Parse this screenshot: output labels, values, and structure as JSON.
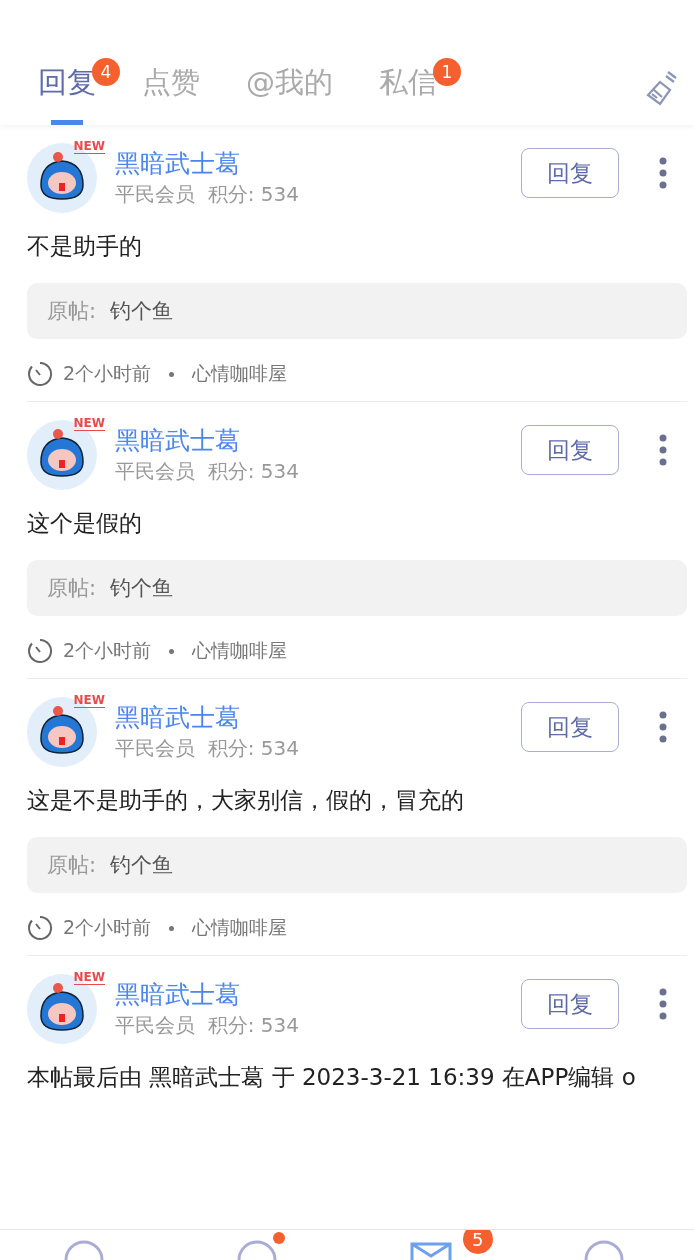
{
  "tabs": [
    {
      "label": "回复",
      "selected": true,
      "badge": "4"
    },
    {
      "label": "点赞",
      "selected": false
    },
    {
      "label": "@我的",
      "selected": false
    },
    {
      "label": "私信",
      "selected": false,
      "badge": "1"
    }
  ],
  "items": [
    {
      "avatar_tag": "NEW",
      "name": "黑暗武士葛",
      "meta": "平民会员  积分: 534",
      "reply_button": "回复",
      "body": "不是助手的",
      "quote_label": "原帖:",
      "quote_title": "钓个鱼",
      "time": "2个小时前",
      "forum": "心情咖啡屋"
    },
    {
      "avatar_tag": "NEW",
      "name": "黑暗武士葛",
      "meta": "平民会员  积分: 534",
      "reply_button": "回复",
      "body": "这个是假的",
      "quote_label": "原帖:",
      "quote_title": "钓个鱼",
      "time": "2个小时前",
      "forum": "心情咖啡屋"
    },
    {
      "avatar_tag": "NEW",
      "name": "黑暗武士葛",
      "meta": "平民会员  积分: 534",
      "reply_button": "回复",
      "body": "这是不是助手的，大家别信，假的，冒充的",
      "quote_label": "原帖:",
      "quote_title": "钓个鱼",
      "time": "2个小时前",
      "forum": "心情咖啡屋"
    },
    {
      "avatar_tag": "NEW",
      "name": "黑暗武士葛",
      "meta": "平民会员  积分: 534",
      "reply_button": "回复",
      "body": "本帖最后由 黑暗武士葛 于 2023-3-21 16:39 在APP编辑 o"
    }
  ],
  "bottom_nav": [
    {
      "kind": "plain"
    },
    {
      "kind": "dot"
    },
    {
      "kind": "count",
      "badge": "5"
    },
    {
      "kind": "plain"
    }
  ]
}
